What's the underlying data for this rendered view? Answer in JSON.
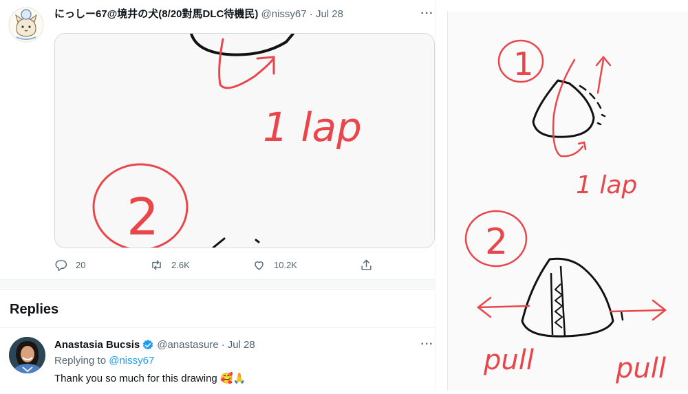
{
  "tweet": {
    "author_name": "にっしー67@境井の犬(8/20對馬DLC待機民)",
    "author_handle": "@nissy67",
    "separator": "·",
    "time": "Jul 28",
    "more_label": "···",
    "media": {
      "labels": {
        "step2": "2",
        "lap": "1 lap"
      }
    },
    "actions": {
      "reply_count": "20",
      "retweet_count": "2.6K",
      "like_count": "10.2K"
    }
  },
  "replies": {
    "title": "Replies",
    "items": [
      {
        "author_name": "Anastasia Bucsis",
        "verified": true,
        "author_handle": "@anastasure",
        "separator": "·",
        "time": "Jul 28",
        "more_label": "···",
        "replying_prefix": "Replying to",
        "replying_to": "@nissy67",
        "text": "Thank you so much for this drawing",
        "emojis": "🥰🙏"
      }
    ]
  },
  "drawing": {
    "labels": {
      "step1": "1",
      "lap": "1 lap",
      "step2": "2",
      "pull_left": "pull",
      "pull_right": "pull"
    }
  },
  "colors": {
    "ink_red": "#e8464a",
    "ink_black": "#111111",
    "link": "#1d9bf0",
    "secondary": "#536471",
    "verified": "#1d9bf0"
  },
  "icons": [
    "reply-icon",
    "retweet-icon",
    "like-icon",
    "share-icon",
    "verified-badge-icon",
    "more-icon"
  ]
}
